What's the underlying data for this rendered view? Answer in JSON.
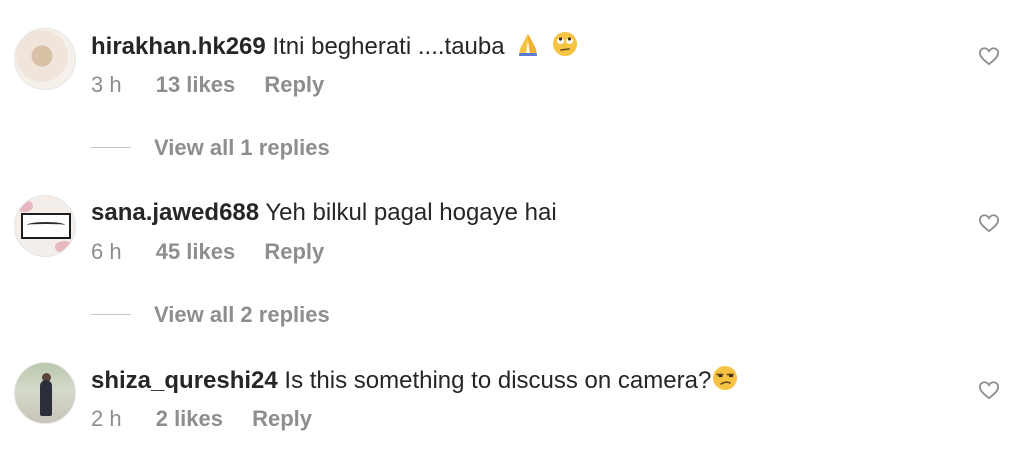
{
  "comments": [
    {
      "username": "hirakhan.hk269",
      "text": "Itni begherati ....tauba",
      "emojis": [
        "folded-hands",
        "eye-roll"
      ],
      "time": "3 h",
      "likes": "13 likes",
      "reply": "Reply",
      "view_replies": "View all 1 replies"
    },
    {
      "username": "sana.jawed688",
      "text": "Yeh bilkul pagal hogaye hai",
      "time": "6 h",
      "likes": "45 likes",
      "reply": "Reply",
      "view_replies": "View all 2 replies"
    },
    {
      "username": "shiza_qureshi24",
      "text": "Is this something to discuss on camera?",
      "emojis": [
        "unamused"
      ],
      "time": "2 h",
      "likes": "2 likes",
      "reply": "Reply"
    }
  ],
  "colors": {
    "text": "#262626",
    "muted": "#8e8e8e",
    "divider": "#c7c7c7",
    "emoji": "#f6c343"
  }
}
